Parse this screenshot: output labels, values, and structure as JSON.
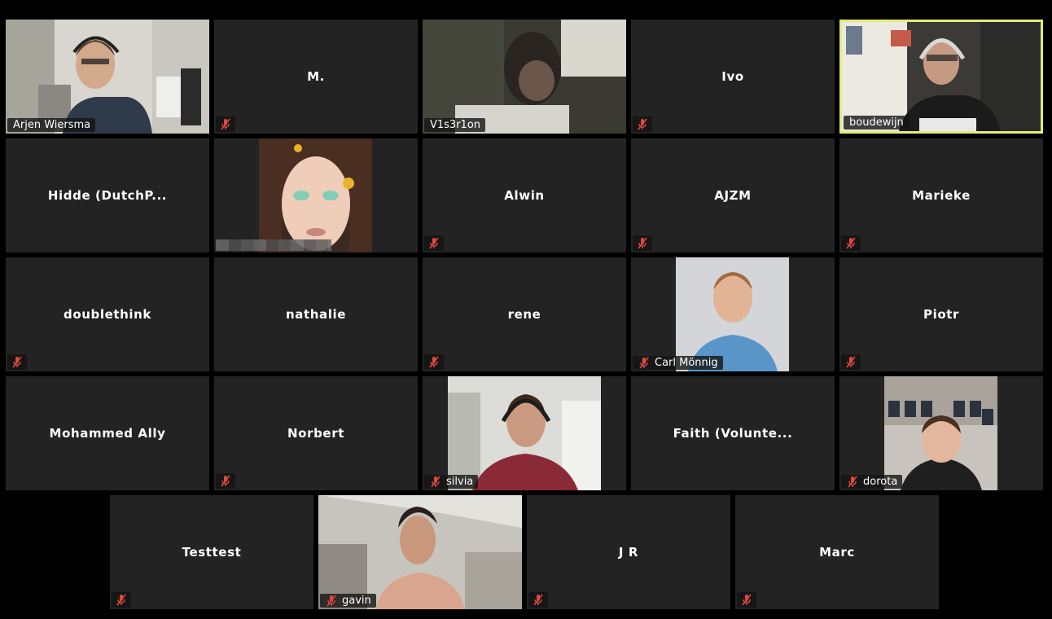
{
  "colors": {
    "tile_bg": "#232323",
    "active_speaker_border": "#e3ec7a",
    "muted_icon": "#e0483e"
  },
  "participants": [
    {
      "name": "Arjen Wiersma",
      "video": true,
      "muted": false,
      "active": false
    },
    {
      "name": "M.",
      "video": false,
      "muted": true
    },
    {
      "name": "V1s3r1on",
      "video": true,
      "muted": false
    },
    {
      "name": "Ivo",
      "video": false,
      "muted": true
    },
    {
      "name": "boudewijn",
      "video": true,
      "muted": false,
      "active": true
    },
    {
      "name": "Hidde (DutchP...",
      "video": false,
      "muted": false
    },
    {
      "name": "",
      "video": true,
      "muted": false,
      "label_obscured": true
    },
    {
      "name": "Alwin",
      "video": false,
      "muted": true
    },
    {
      "name": "AJZM",
      "video": false,
      "muted": true
    },
    {
      "name": "Marieke",
      "video": false,
      "muted": true
    },
    {
      "name": "doublethink",
      "video": false,
      "muted": true
    },
    {
      "name": "nathalie",
      "video": false,
      "muted": false
    },
    {
      "name": "rene",
      "video": false,
      "muted": true
    },
    {
      "name": "Carl Mönnig",
      "video": true,
      "muted": true
    },
    {
      "name": "Piotr",
      "video": false,
      "muted": true
    },
    {
      "name": "Mohammed Ally",
      "video": false,
      "muted": false
    },
    {
      "name": "Norbert",
      "video": false,
      "muted": true
    },
    {
      "name": "silvia",
      "video": true,
      "muted": true
    },
    {
      "name": "Faith (Volunte...",
      "video": false,
      "muted": false
    },
    {
      "name": "dorota",
      "video": true,
      "muted": true
    },
    {
      "name": "Testtest",
      "video": false,
      "muted": true
    },
    {
      "name": "gavin",
      "video": true,
      "muted": true
    },
    {
      "name": "J R",
      "video": false,
      "muted": true
    },
    {
      "name": "Marc",
      "video": false,
      "muted": true
    }
  ]
}
